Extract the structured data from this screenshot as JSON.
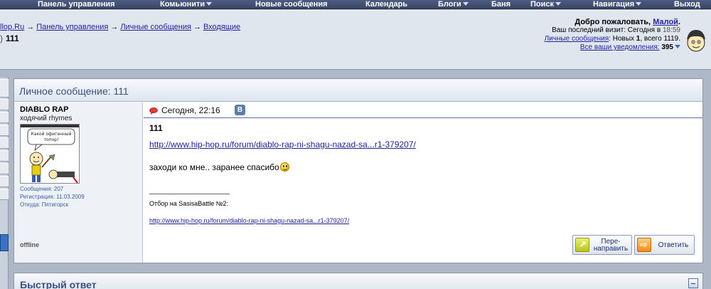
{
  "topnav": {
    "items": [
      {
        "label": "Панель управления"
      },
      {
        "label": "Комьюнити"
      },
      {
        "label": "Новые сообщения"
      },
      {
        "label": "Календарь"
      },
      {
        "label": "Блоги"
      },
      {
        "label": "Баня"
      },
      {
        "label": "Поиск"
      },
      {
        "label": "Навигация"
      },
      {
        "label": "Выход"
      }
    ]
  },
  "breadcrumb": {
    "items": [
      "llop.Ru",
      "Панель управления",
      "Личные сообщения",
      "Входящие"
    ],
    "arrow": "→",
    "current": "111"
  },
  "welcome": {
    "greeting": "Добро пожаловать,",
    "username": "Малой",
    "last_visit_label": "Ваш последний визит: Сегодня в",
    "last_visit_time": "18:59",
    "pm_link": "Личные сообщения",
    "pm_text_pre": ": Новых",
    "pm_new": "1",
    "pm_text_post": ", всего 1119.",
    "notifications_link": "Все ваши уведомления:",
    "notifications_count": "395"
  },
  "pm": {
    "title_label": "Личное сообщение",
    "title_subject": ": 111",
    "user": {
      "name": "DIABLO RAP",
      "title": "ходячий rhymes",
      "avatar_text": "Какой офигенный топор!",
      "posts": "Сообщения: 207",
      "registered": "Регистрация: 11.03.2009",
      "location": "Откуда: Пятигорск",
      "status": "offline"
    },
    "message": {
      "date": "Сегодня, 22:16",
      "vk_badge": "B",
      "title": "111",
      "link": "http://www.hip-hop.ru/forum/diablo-rap-ni-shagu-nazad-sa...r1-379207/",
      "text": "заходи ко мне.. заранее спасибо",
      "signature_text": "Отбор на SasisaBattle №2:",
      "signature_link": "http://www.hip-hop.ru/forum/diablo-rap-ni-shagu-nazad-sa...r1-379207/"
    },
    "buttons": {
      "forward_line1": "Пере-",
      "forward_line2": "направить",
      "reply": "Ответить"
    }
  },
  "quick_reply": {
    "title": "Быстрый ответ"
  },
  "colors": {
    "nav_bg": "#3a4666",
    "link": "#22229c",
    "title": "#3b4f80",
    "accent_blue": "#3b72c4"
  }
}
